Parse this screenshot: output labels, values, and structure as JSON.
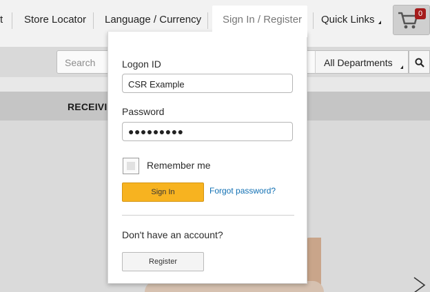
{
  "topnav": {
    "items": [
      {
        "label": "t"
      },
      {
        "label": "Store Locator"
      },
      {
        "label": "Language / Currency"
      },
      {
        "label": "Sign In / Register"
      },
      {
        "label": "Quick Links"
      }
    ],
    "cart_count": "0"
  },
  "searchbar": {
    "placeholder": "Search",
    "department": "All Departments"
  },
  "banner": {
    "text": "RECEIVI"
  },
  "signin": {
    "logon_label": "Logon ID",
    "logon_value": "CSR Example",
    "password_label": "Password",
    "password_value": "●●●●●●●●●",
    "remember_label": "Remember me",
    "remember_checked": false,
    "signin_button": "Sign In",
    "forgot_link": "Forgot password?",
    "no_account_text": "Don't have an account?",
    "register_button": "Register"
  },
  "colors": {
    "accent": "#f7b320",
    "link": "#0f6fb3",
    "badge": "#a51b1b"
  },
  "icons": [
    "cart-icon",
    "search-icon",
    "dropdown-arrow-icon",
    "next-arrow-icon"
  ]
}
